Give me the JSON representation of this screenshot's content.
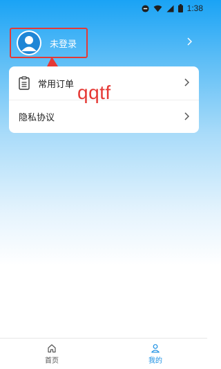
{
  "status_bar": {
    "time": "1:38"
  },
  "profile": {
    "login_label": "未登录"
  },
  "menu": {
    "items": [
      {
        "label": "常用订单",
        "icon": "clipboard-icon"
      },
      {
        "label": "隐私协议"
      }
    ]
  },
  "annotation": {
    "text": "qqtf",
    "color": "#e53935"
  },
  "tabbar": {
    "tabs": [
      {
        "label": "首页",
        "icon": "home-icon",
        "active": false
      },
      {
        "label": "我的",
        "icon": "user-icon",
        "active": true
      }
    ]
  },
  "colors": {
    "accent": "#1a8fe3",
    "annotation_red": "#e53935",
    "header_blue": "#1aa3f5"
  }
}
